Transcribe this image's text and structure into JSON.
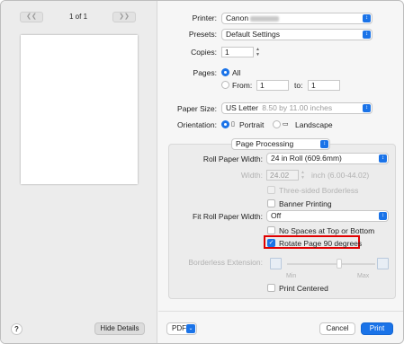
{
  "preview": {
    "prev_icon": "chevron-double-left",
    "next_icon": "chevron-double-right",
    "page_indicator": "1 of 1",
    "help_label": "?",
    "hide_details_label": "Hide Details"
  },
  "form": {
    "printer_label": "Printer:",
    "printer_value": "Canon",
    "presets_label": "Presets:",
    "presets_value": "Default Settings",
    "copies_label": "Copies:",
    "copies_value": "1",
    "pages_label": "Pages:",
    "pages_all_label": "All",
    "pages_from_label": "From:",
    "pages_from_value": "1",
    "pages_to_label": "to:",
    "pages_to_value": "1",
    "paper_size_label": "Paper Size:",
    "paper_size_value": "US Letter",
    "paper_size_dims": "8.50 by 11.00 inches",
    "orientation_label": "Orientation:",
    "orientation_portrait_label": "Portrait",
    "orientation_landscape_label": "Landscape",
    "section_popup_value": "Page Processing"
  },
  "processing": {
    "roll_width_label": "Roll Paper Width:",
    "roll_width_value": "24 in Roll (609.6mm)",
    "width_label": "Width:",
    "width_value": "24.02",
    "width_unit": "inch (6.00-44.02)",
    "three_sided_label": "Three-sided Borderless",
    "banner_label": "Banner Printing",
    "fit_roll_label": "Fit Roll Paper Width:",
    "fit_roll_value": "Off",
    "no_spaces_label": "No Spaces at Top or Bottom",
    "rotate_label": "Rotate Page 90 degrees",
    "borderless_ext_label": "Borderless Extension:",
    "slider_min_label": "Min",
    "slider_max_label": "Max",
    "slider_value": 0.55,
    "print_centered_label": "Print Centered"
  },
  "footer": {
    "pdf_label": "PDF",
    "cancel_label": "Cancel",
    "print_label": "Print"
  },
  "colors": {
    "accent": "#1a73e8",
    "highlight": "#e00000"
  }
}
